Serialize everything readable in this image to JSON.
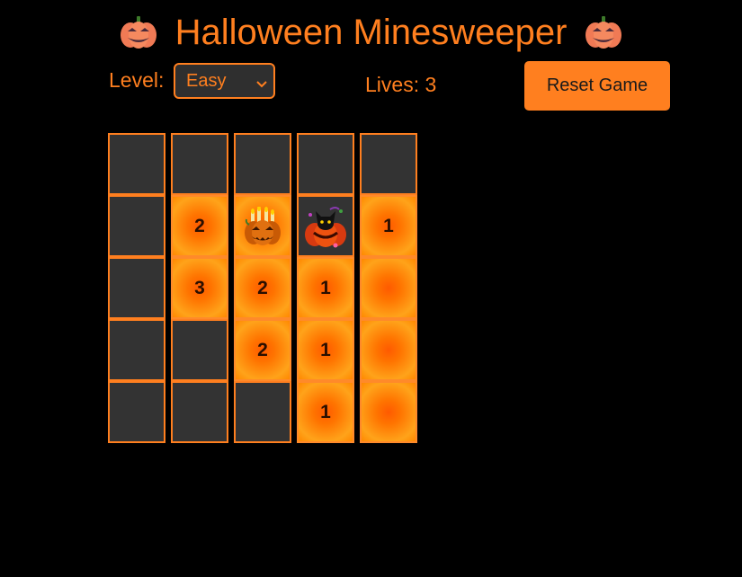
{
  "header": {
    "title": "Halloween Minesweeper",
    "left_icon": "pumpkin-icon",
    "right_icon": "pumpkin-icon"
  },
  "controls": {
    "level_label": "Level:",
    "level_value": "Easy",
    "lives_text": "Lives: 3",
    "reset_label": "Reset Game"
  },
  "colors": {
    "accent": "#ff7f1f",
    "background": "#000000",
    "hidden_cell": "#333333"
  },
  "board": {
    "columns": [
      [
        {
          "state": "hidden",
          "text": ""
        },
        {
          "state": "hidden",
          "text": ""
        },
        {
          "state": "hidden",
          "text": ""
        },
        {
          "state": "hidden",
          "text": ""
        },
        {
          "state": "hidden",
          "text": ""
        }
      ],
      [
        {
          "state": "hidden",
          "text": ""
        },
        {
          "state": "revealed",
          "text": "2"
        },
        {
          "state": "revealed",
          "text": "3"
        },
        {
          "state": "hidden",
          "text": ""
        },
        {
          "state": "hidden",
          "text": ""
        }
      ],
      [
        {
          "state": "hidden",
          "text": ""
        },
        {
          "state": "revealed-pumpkin",
          "text": "",
          "icon": "candle-pumpkin-icon"
        },
        {
          "state": "revealed",
          "text": "2"
        },
        {
          "state": "revealed",
          "text": "2"
        },
        {
          "state": "hidden",
          "text": ""
        }
      ],
      [
        {
          "state": "hidden",
          "text": ""
        },
        {
          "state": "mine",
          "text": "",
          "icon": "cat-pumpkin-icon"
        },
        {
          "state": "revealed",
          "text": "1"
        },
        {
          "state": "revealed",
          "text": "1"
        },
        {
          "state": "revealed",
          "text": "1"
        }
      ],
      [
        {
          "state": "hidden",
          "text": ""
        },
        {
          "state": "revealed",
          "text": "1"
        },
        {
          "state": "revealed",
          "text": ""
        },
        {
          "state": "revealed",
          "text": ""
        },
        {
          "state": "revealed",
          "text": ""
        }
      ]
    ]
  }
}
